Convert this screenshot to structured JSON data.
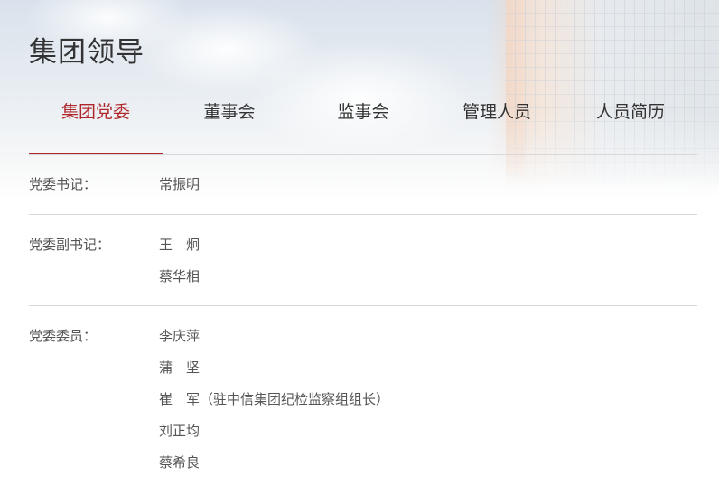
{
  "page": {
    "title": "集团领导"
  },
  "tabs": [
    {
      "label": "集团党委",
      "active": true
    },
    {
      "label": "董事会",
      "active": false
    },
    {
      "label": "监事会",
      "active": false
    },
    {
      "label": "管理人员",
      "active": false
    },
    {
      "label": "人员简历",
      "active": false
    }
  ],
  "sections": [
    {
      "label": "党委书记：",
      "names": [
        "常振明"
      ]
    },
    {
      "label": "党委副书记：",
      "names": [
        "王　炯",
        "蔡华相"
      ]
    },
    {
      "label": "党委委员：",
      "names": [
        "李庆萍",
        "蒲　坚",
        "崔　军（驻中信集团纪检监察组组长）",
        "刘正均",
        "蔡希良"
      ]
    }
  ],
  "colors": {
    "accent": "#b0272b",
    "text": "#555555",
    "title": "#333333",
    "divider": "#d8d8d8"
  }
}
